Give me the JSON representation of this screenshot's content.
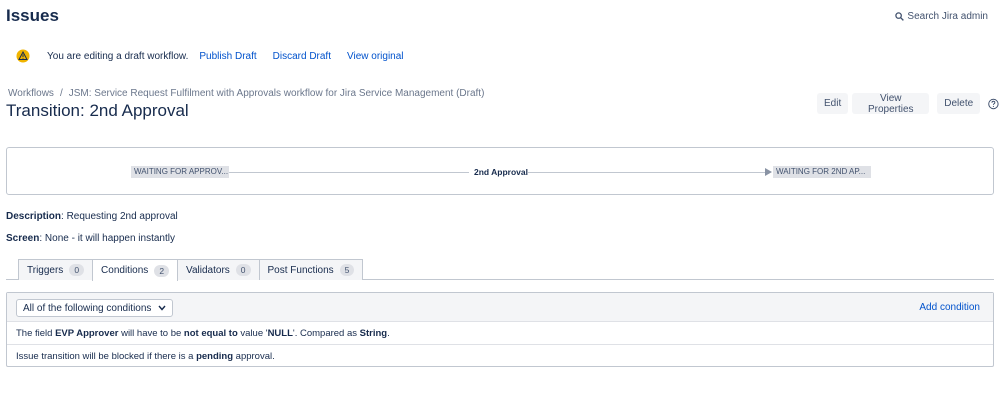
{
  "header": {
    "title": "Issues",
    "search_label": "Search Jira admin"
  },
  "draft_bar": {
    "message": "You are editing a draft workflow.",
    "publish": "Publish Draft",
    "discard": "Discard Draft",
    "view_original": "View original"
  },
  "breadcrumb": {
    "root": "Workflows",
    "separator": "/",
    "workflow": "JSM: Service Request Fulfilment with Approvals workflow for Jira Service Management (Draft)"
  },
  "transition_title": "Transition: 2nd Approval",
  "actions": {
    "edit": "Edit",
    "view_properties": "View Properties",
    "delete": "Delete"
  },
  "diagram": {
    "from_status": "WAITING FOR APPROV...",
    "transition": "2nd Approval",
    "to_status": "WAITING FOR 2ND AP..."
  },
  "details": {
    "description_label": "Description",
    "description_value": ": Requesting 2nd approval",
    "screen_label": "Screen",
    "screen_value": ": None - it will happen instantly"
  },
  "tabs": [
    {
      "label": "Triggers",
      "count": "0"
    },
    {
      "label": "Conditions",
      "count": "2"
    },
    {
      "label": "Validators",
      "count": "0"
    },
    {
      "label": "Post Functions",
      "count": "5"
    }
  ],
  "conditions": {
    "select_value": "All of the following conditions",
    "add_label": "Add condition",
    "row1": {
      "p1": "The field ",
      "field": "EVP Approver",
      "p2": " will have to be ",
      "op": "not equal to",
      "p3": " value '",
      "value": "NULL",
      "p4": "'. Compared as ",
      "type": "String",
      "p5": "."
    },
    "row2": {
      "p1": "Issue transition will be blocked if there is a ",
      "word": "pending",
      "p2": " approval."
    }
  },
  "colors": {
    "link": "#0052cc",
    "warning": "#f0b400",
    "status_bg": "#dfe1e6"
  }
}
